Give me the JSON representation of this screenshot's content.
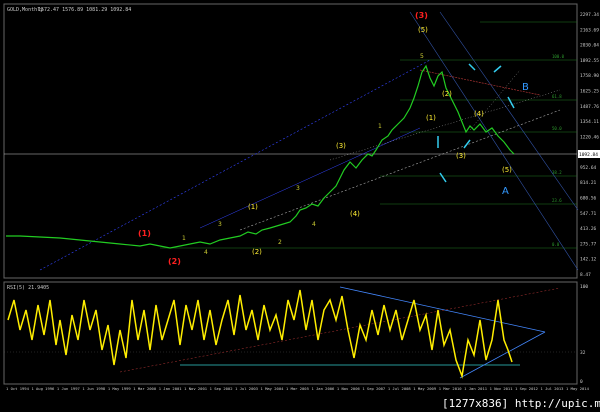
{
  "header": {
    "title": "GOLD,Monthly",
    "ohlc": "1572.47 1576.89 1081.29 1092.84",
    "rsi_label": "RSI(5) 21.9405"
  },
  "price_axis": [
    "2297.34",
    "2163.69",
    "2030.04",
    "1892.55",
    "1758.90",
    "1625.25",
    "1487.76",
    "1354.11",
    "1220.46",
    "1082.97",
    "952.64",
    "814.21",
    "680.56",
    "547.71",
    "413.26",
    "275.77",
    "142.12",
    "8.47"
  ],
  "rsi_axis": [
    "100",
    "32",
    "0"
  ],
  "current_price_tag": "1092.84",
  "time_axis": [
    "1 Oct 1994",
    "1 Aug 1996",
    "1 Jun 1997",
    "1 Jun 1998",
    "1 May 1999",
    "1 Mar 2000",
    "1 Jan 2001",
    "1 Nov 2001",
    "1 Sep 2002",
    "1 Jul 2003",
    "1 May 2004",
    "1 Mar 2005",
    "1 Jan 2006",
    "1 Nov 2006",
    "1 Sep 2007",
    "1 Jul 2008",
    "1 May 2009",
    "1 Mar 2010",
    "1 Jan 2011",
    "1 Nov 2011",
    "1 Sep 2012",
    "1 Jul 2013",
    "1 May 2014"
  ],
  "fib_levels": [
    "100.0",
    "61.8",
    "50.0",
    "38.2",
    "23.6",
    "0.0"
  ],
  "watermark": "[1277x836] http://upic.me/",
  "wave_labels": {
    "primary": [
      "(1)",
      "(2)",
      "(3)"
    ],
    "intermediate": [
      "1",
      "2",
      "3",
      "4",
      "5",
      "(1)",
      "(2)",
      "(3)",
      "(4)",
      "(5)"
    ],
    "minor_circled": [
      "(1)",
      "(2)",
      "(3)",
      "(4)",
      "(5)"
    ],
    "corrective": [
      "A",
      "B"
    ]
  },
  "colors": {
    "background": "#000000",
    "price": "#22cc22",
    "rsi": "#ffee00",
    "primary_wave": "#ff2020",
    "minor_wave": "#ffee33",
    "abc": "#3399ff",
    "arrow": "#33ccee",
    "fib": "#2e7d32"
  }
}
